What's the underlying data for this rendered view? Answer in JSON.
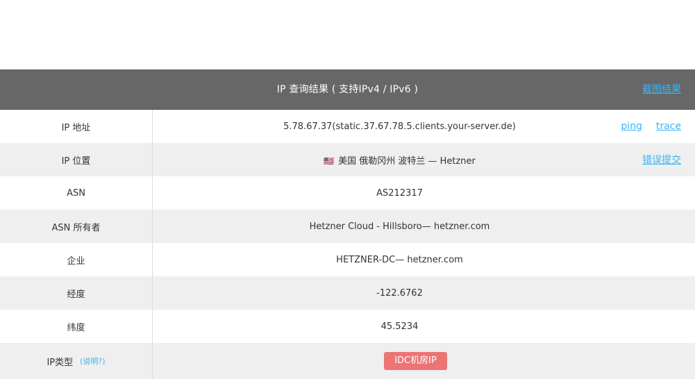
{
  "header": {
    "title": "IP 查询结果 ( 支持IPv4 / IPv6 )",
    "screenshot_link": "截图结果"
  },
  "rows": {
    "ip": {
      "label": "IP 地址",
      "value": "5.78.67.37(static.37.67.78.5.clients.your-server.de)",
      "ping_label": "ping",
      "trace_label": "trace"
    },
    "location": {
      "label": "IP 位置",
      "flag": "🇺🇸",
      "value": "美国 俄勒冈州 波特兰 — Hetzner",
      "report_label": "错误提交"
    },
    "asn": {
      "label": "ASN",
      "value": "AS212317"
    },
    "asn_owner": {
      "label": "ASN 所有者",
      "value": "Hetzner Cloud - Hillsboro— hetzner.com"
    },
    "enterprise": {
      "label": "企业",
      "value": "HETZNER-DC— hetzner.com"
    },
    "longitude": {
      "label": "经度",
      "value": "-122.6762"
    },
    "latitude": {
      "label": "纬度",
      "value": "45.5234"
    },
    "ip_type": {
      "label": "IP类型",
      "help_label": "(说明?)",
      "badge": "IDC机房IP"
    }
  },
  "colors": {
    "header_bg": "#676767",
    "link": "#3ab4f2",
    "badge_bg": "#ec7474",
    "alt_row_bg": "#efefef"
  }
}
